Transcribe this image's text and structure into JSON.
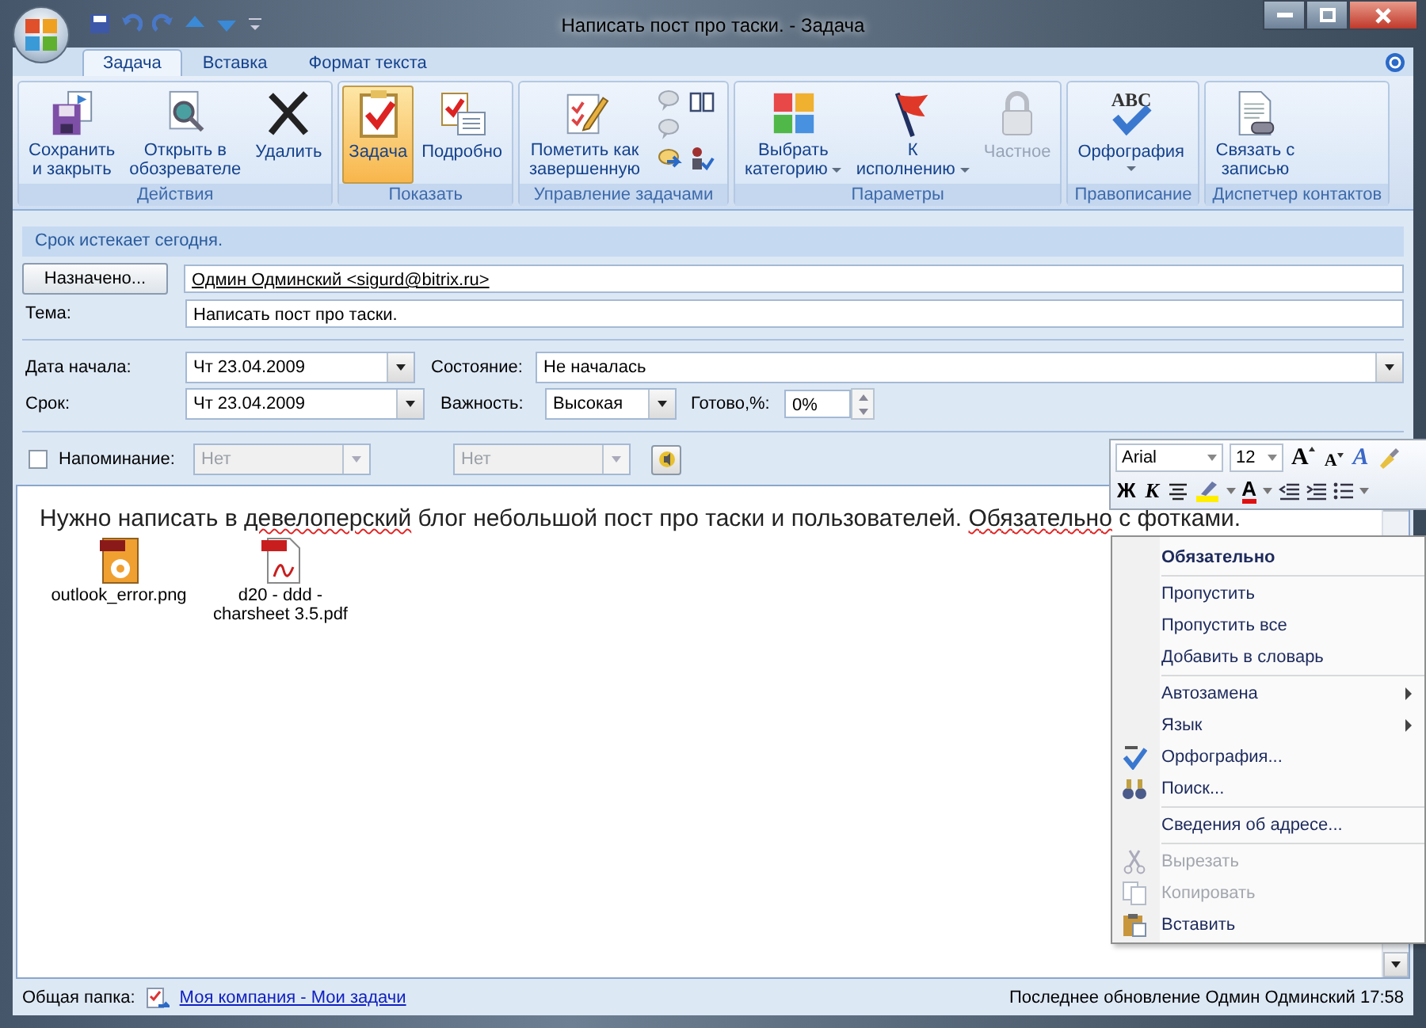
{
  "window": {
    "title": "Написать пост про таски. - Задача"
  },
  "tabs": [
    {
      "label": "Задача",
      "selected": true
    },
    {
      "label": "Вставка",
      "selected": false
    },
    {
      "label": "Формат текста",
      "selected": false
    }
  ],
  "ribbon": {
    "groups": [
      {
        "label": "Действия",
        "buttons": [
          {
            "lines": [
              "Сохранить",
              "и закрыть"
            ],
            "selected": false,
            "disabled": false,
            "dropdown": false
          },
          {
            "lines": [
              "Открыть в",
              "обозревателе"
            ],
            "selected": false,
            "disabled": false,
            "dropdown": false
          },
          {
            "lines": [
              "Удалить"
            ],
            "selected": false,
            "disabled": false,
            "dropdown": false
          }
        ]
      },
      {
        "label": "Показать",
        "buttons": [
          {
            "lines": [
              "Задача"
            ],
            "selected": true,
            "disabled": false,
            "dropdown": false
          },
          {
            "lines": [
              "Подробно"
            ],
            "selected": false,
            "disabled": false,
            "dropdown": false
          }
        ]
      },
      {
        "label": "Управление задачами",
        "buttons": [
          {
            "lines": [
              "Пометить как",
              "завершенную"
            ],
            "selected": false,
            "disabled": false,
            "dropdown": false
          }
        ]
      },
      {
        "label": "Параметры",
        "buttons": [
          {
            "lines": [
              "Выбрать",
              "категорию"
            ],
            "selected": false,
            "disabled": false,
            "dropdown": true
          },
          {
            "lines": [
              "К",
              "исполнению"
            ],
            "selected": false,
            "disabled": false,
            "dropdown": true
          },
          {
            "lines": [
              "Частное"
            ],
            "selected": false,
            "disabled": true,
            "dropdown": false
          }
        ]
      },
      {
        "label": "Правописание",
        "buttons": [
          {
            "lines": [
              "Орфография"
            ],
            "selected": false,
            "disabled": false,
            "dropdown": true,
            "icon_text": "ABC"
          }
        ]
      },
      {
        "label": "Диспетчер контактов",
        "buttons": [
          {
            "lines": [
              "Связать с",
              "записью"
            ],
            "selected": false,
            "disabled": false,
            "dropdown": false
          }
        ]
      }
    ]
  },
  "info_bar": "Срок истекает сегодня.",
  "assigned": {
    "button": "Назначено...",
    "value": "Одмин Одминский <sigurd@bitrix.ru>"
  },
  "subject": {
    "label": "Тема:",
    "value": "Написать пост про таски."
  },
  "start_date": {
    "label": "Дата начала:",
    "value": "Чт 23.04.2009"
  },
  "status": {
    "label": "Состояние:",
    "value": "Не началась"
  },
  "due_date": {
    "label": "Срок:",
    "value": "Чт 23.04.2009"
  },
  "priority": {
    "label": "Важность:",
    "value": "Высокая"
  },
  "percent": {
    "label": "Готово,%:",
    "value": "0%"
  },
  "reminder": {
    "label": "Напоминание:",
    "checked": false,
    "disabled": true,
    "date": "Нет",
    "time": "Нет"
  },
  "body": {
    "text": [
      {
        "text": "Нужно написать в ",
        "misspelled": false
      },
      {
        "text": "девелоперский",
        "misspelled": true
      },
      {
        "text": " блог небольшой пост про таски и пользователей. ",
        "misspelled": false
      },
      {
        "text": "Обязательно",
        "misspelled": true
      },
      {
        "text": " с фотками.",
        "misspelled": false
      }
    ],
    "attachments": [
      {
        "name": "outlook_error.png",
        "kind": "image"
      },
      {
        "name": "d20 - ddd - charsheet 3.5.pdf",
        "kind": "pdf"
      }
    ]
  },
  "mini_toolbar": {
    "font": "Arial",
    "size": "12",
    "grow": "A",
    "shrink": "A",
    "styles": "A",
    "bold": "Ж",
    "italic": "К",
    "font_color": "A"
  },
  "context_menu": [
    {
      "label": "Обязательно",
      "bold": true,
      "disabled": false,
      "submenu": false,
      "divider_after": true
    },
    {
      "label": "Пропустить",
      "bold": false,
      "disabled": false,
      "submenu": false,
      "divider_after": false
    },
    {
      "label": "Пропустить все",
      "bold": false,
      "disabled": false,
      "submenu": false,
      "divider_after": false
    },
    {
      "label": "Добавить в словарь",
      "bold": false,
      "disabled": false,
      "submenu": false,
      "divider_after": true
    },
    {
      "label": "Автозамена",
      "bold": false,
      "disabled": false,
      "submenu": true,
      "divider_after": false
    },
    {
      "label": "Язык",
      "bold": false,
      "disabled": false,
      "submenu": true,
      "divider_after": false
    },
    {
      "label": "Орфография...",
      "bold": false,
      "disabled": false,
      "submenu": false,
      "divider_after": false
    },
    {
      "label": "Поиск...",
      "bold": false,
      "disabled": false,
      "submenu": false,
      "divider_after": true
    },
    {
      "label": "Сведения об адресе...",
      "bold": false,
      "disabled": false,
      "submenu": false,
      "divider_after": true
    },
    {
      "label": "Вырезать",
      "bold": false,
      "disabled": true,
      "submenu": false,
      "divider_after": false
    },
    {
      "label": "Копировать",
      "bold": false,
      "disabled": true,
      "submenu": false,
      "divider_after": false
    },
    {
      "label": "Вставить",
      "bold": false,
      "disabled": false,
      "submenu": false,
      "divider_after": false
    }
  ],
  "status_bar": {
    "folder_label": "Общая папка:",
    "folder_link": "Моя компания - Мои задачи",
    "last_update": "Последнее обновление Одмин Одминский 17:58"
  }
}
